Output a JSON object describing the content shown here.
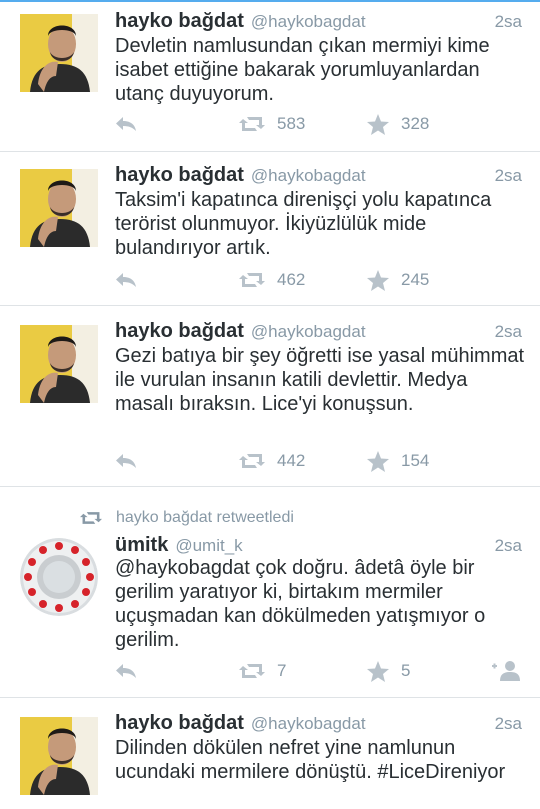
{
  "colors": {
    "accent": "#55acee",
    "text": "#292f33",
    "muted": "#8899a6",
    "icon": "#b8c2ca",
    "divider": "#dfe3e6"
  },
  "tweets": [
    {
      "name": "hayko bağdat",
      "handle": "@haykobagdat",
      "time": "2sa",
      "text": "Devletin namlusundan çıkan mermiyi kime isabet ettiğine bakarak yorumluyanlardan utanç duyuyorum.",
      "retweets": "583",
      "favorites": "328",
      "avatar_icon": "profile-photo-hayko"
    },
    {
      "name": "hayko bağdat",
      "handle": "@haykobagdat",
      "time": "2sa",
      "text": "Taksim'i kapatınca direnişçi yolu kapatınca terörist olunmuyor. İkiyüzlülük mide bulandırıyor artık.",
      "retweets": "462",
      "favorites": "245",
      "avatar_icon": "profile-photo-hayko"
    },
    {
      "name": "hayko bağdat",
      "handle": "@haykobagdat",
      "time": "2sa",
      "text": "Gezi batıya bir şey öğretti ise yasal mühimmat ile vurulan insanın katili devlettir. Medya masalı bıraksın. Lice'yi konuşsun.",
      "retweets": "442",
      "favorites": "154",
      "avatar_icon": "profile-photo-hayko"
    },
    {
      "retweeted_by": "hayko bağdat retweetledi",
      "name": "ümitk",
      "handle": "@umit_k",
      "time": "2sa",
      "text": "@haykobagdat çok doğru. âdetâ öyle bir gerilim yaratıyor ki, birtakım mermiler uçuşmadan kan dökülmeden yatışmıyor o gerilim.",
      "retweets": "7",
      "favorites": "5",
      "avatar_icon": "profile-photo-umit"
    },
    {
      "name": "hayko bağdat",
      "handle": "@haykobagdat",
      "time": "2sa",
      "text": "Dilinden dökülen nefret yine namlunun ucundaki mermilere dönüştü. #LiceDireniyor",
      "avatar_icon": "profile-photo-hayko"
    }
  ]
}
